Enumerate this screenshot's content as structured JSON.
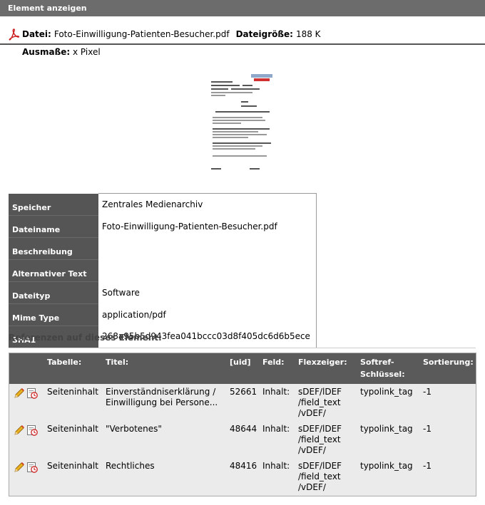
{
  "window": {
    "title": "Element anzeigen"
  },
  "file": {
    "label_file": "Datei:",
    "filename": "Foto-Einwilligung-Patienten-Besucher.pdf",
    "label_size": "Dateigröße:",
    "size": "188 K",
    "label_dimensions": "Ausmaße:",
    "dimensions": "x Pixel"
  },
  "properties": [
    {
      "key": "Speicher",
      "value": "Zentrales Medienarchiv"
    },
    {
      "key": "Dateiname",
      "value": "Foto-Einwilligung-Patienten-Besucher.pdf"
    },
    {
      "key": "Beschreibung",
      "value": ""
    },
    {
      "key": "Alternativer Text",
      "value": ""
    },
    {
      "key": "Dateityp",
      "value": "Software"
    },
    {
      "key": "Mime Type",
      "value": "application/pdf"
    },
    {
      "key": "SHA1",
      "value": "268a95b5d943fea041bccc03d8f405dc6d6b5ece"
    }
  ],
  "references": {
    "heading": "Referenzen auf dieses Element:",
    "columns": {
      "table": "Tabelle:",
      "title": "Titel:",
      "uid": "[uid]",
      "field": "Feld:",
      "flexpointer": "Flexzeiger:",
      "softref_1": "Softref-",
      "softref_2": "Schlüssel:",
      "sorting": "Sortierung:"
    },
    "rows": [
      {
        "table": "Seiteninhalt",
        "title_1": "Einverständniserklärung /",
        "title_2": "Einwilligung bei Persone...",
        "uid": "52661",
        "field": "Inhalt:",
        "flex_1": "sDEF/lDEF",
        "flex_2": "/field_text",
        "flex_3": "/vDEF/",
        "softref": "typolink_tag",
        "sorting": "-1"
      },
      {
        "table": "Seiteninhalt",
        "title_1": "\"Verbotenes\"",
        "title_2": "",
        "uid": "48644",
        "field": "Inhalt:",
        "flex_1": "sDEF/lDEF",
        "flex_2": "/field_text",
        "flex_3": "/vDEF/",
        "softref": "typolink_tag",
        "sorting": "-1"
      },
      {
        "table": "Seiteninhalt",
        "title_1": "Rechtliches",
        "title_2": "",
        "uid": "48416",
        "field": "Inhalt:",
        "flex_1": "sDEF/lDEF",
        "flex_2": "/field_text",
        "flex_3": "/vDEF/",
        "softref": "typolink_tag",
        "sorting": "-1"
      }
    ]
  },
  "icons": {
    "file_type": "pdf-icon",
    "edit": "pencil-icon",
    "history": "history-icon"
  },
  "colors": {
    "titlebar": "#6c6c6c",
    "label_bg": "#555555",
    "pdf_red": "#cc1f1f"
  }
}
